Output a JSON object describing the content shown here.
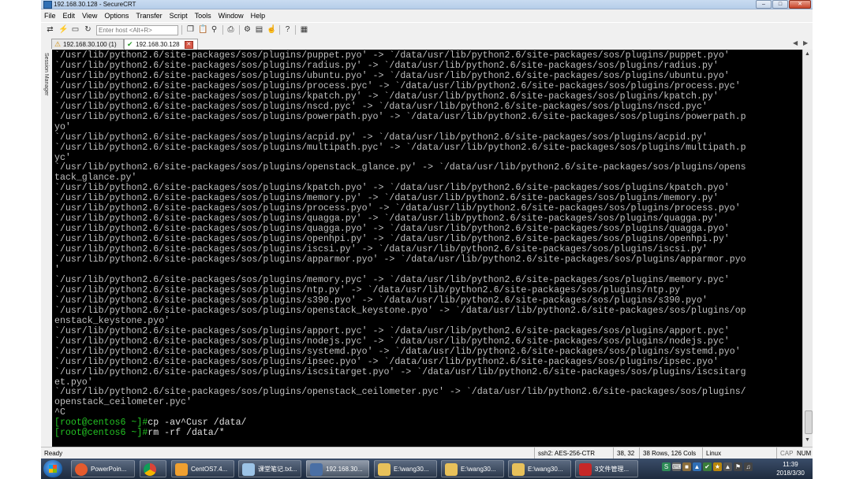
{
  "window": {
    "title": "192.168.30.128 - SecureCRT"
  },
  "menu": [
    "File",
    "Edit",
    "View",
    "Options",
    "Transfer",
    "Script",
    "Tools",
    "Window",
    "Help"
  ],
  "toolbar": {
    "host_placeholder": "Enter host <Alt+R>"
  },
  "tabs": [
    {
      "label": "192.168.30.100 (1)",
      "icon": "warning-icon"
    },
    {
      "label": "192.168.30.128",
      "icon": "check-icon",
      "active": true
    }
  ],
  "session_manager_label": "Session Manager",
  "terminal": {
    "lines": [
      "`/usr/lib/python2.6/site-packages/sos/plugins/puppet.pyo' -> `/data/usr/lib/python2.6/site-packages/sos/plugins/puppet.pyo'",
      "`/usr/lib/python2.6/site-packages/sos/plugins/radius.py' -> `/data/usr/lib/python2.6/site-packages/sos/plugins/radius.py'",
      "`/usr/lib/python2.6/site-packages/sos/plugins/ubuntu.pyo' -> `/data/usr/lib/python2.6/site-packages/sos/plugins/ubuntu.pyo'",
      "`/usr/lib/python2.6/site-packages/sos/plugins/process.pyc' -> `/data/usr/lib/python2.6/site-packages/sos/plugins/process.pyc'",
      "`/usr/lib/python2.6/site-packages/sos/plugins/kpatch.py' -> `/data/usr/lib/python2.6/site-packages/sos/plugins/kpatch.py'",
      "`/usr/lib/python2.6/site-packages/sos/plugins/nscd.pyc' -> `/data/usr/lib/python2.6/site-packages/sos/plugins/nscd.pyc'",
      "`/usr/lib/python2.6/site-packages/sos/plugins/powerpath.pyo' -> `/data/usr/lib/python2.6/site-packages/sos/plugins/powerpath.p",
      "yo'",
      "`/usr/lib/python2.6/site-packages/sos/plugins/acpid.py' -> `/data/usr/lib/python2.6/site-packages/sos/plugins/acpid.py'",
      "`/usr/lib/python2.6/site-packages/sos/plugins/multipath.pyc' -> `/data/usr/lib/python2.6/site-packages/sos/plugins/multipath.p",
      "yc'",
      "`/usr/lib/python2.6/site-packages/sos/plugins/openstack_glance.py' -> `/data/usr/lib/python2.6/site-packages/sos/plugins/opens",
      "tack_glance.py'",
      "`/usr/lib/python2.6/site-packages/sos/plugins/kpatch.pyo' -> `/data/usr/lib/python2.6/site-packages/sos/plugins/kpatch.pyo'",
      "`/usr/lib/python2.6/site-packages/sos/plugins/memory.py' -> `/data/usr/lib/python2.6/site-packages/sos/plugins/memory.py'",
      "`/usr/lib/python2.6/site-packages/sos/plugins/process.pyo' -> `/data/usr/lib/python2.6/site-packages/sos/plugins/process.pyo'",
      "`/usr/lib/python2.6/site-packages/sos/plugins/quagga.py' -> `/data/usr/lib/python2.6/site-packages/sos/plugins/quagga.py'",
      "`/usr/lib/python2.6/site-packages/sos/plugins/quagga.pyo' -> `/data/usr/lib/python2.6/site-packages/sos/plugins/quagga.pyo'",
      "`/usr/lib/python2.6/site-packages/sos/plugins/openhpi.py' -> `/data/usr/lib/python2.6/site-packages/sos/plugins/openhpi.py'",
      "`/usr/lib/python2.6/site-packages/sos/plugins/iscsi.py' -> `/data/usr/lib/python2.6/site-packages/sos/plugins/iscsi.py'",
      "`/usr/lib/python2.6/site-packages/sos/plugins/apparmor.pyo' -> `/data/usr/lib/python2.6/site-packages/sos/plugins/apparmor.pyo",
      "'",
      "`/usr/lib/python2.6/site-packages/sos/plugins/memory.pyc' -> `/data/usr/lib/python2.6/site-packages/sos/plugins/memory.pyc'",
      "`/usr/lib/python2.6/site-packages/sos/plugins/ntp.py' -> `/data/usr/lib/python2.6/site-packages/sos/plugins/ntp.py'",
      "`/usr/lib/python2.6/site-packages/sos/plugins/s390.pyo' -> `/data/usr/lib/python2.6/site-packages/sos/plugins/s390.pyo'",
      "`/usr/lib/python2.6/site-packages/sos/plugins/openstack_keystone.pyo' -> `/data/usr/lib/python2.6/site-packages/sos/plugins/op",
      "enstack_keystone.pyo'",
      "`/usr/lib/python2.6/site-packages/sos/plugins/apport.pyc' -> `/data/usr/lib/python2.6/site-packages/sos/plugins/apport.pyc'",
      "`/usr/lib/python2.6/site-packages/sos/plugins/nodejs.pyc' -> `/data/usr/lib/python2.6/site-packages/sos/plugins/nodejs.pyc'",
      "`/usr/lib/python2.6/site-packages/sos/plugins/systemd.pyo' -> `/data/usr/lib/python2.6/site-packages/sos/plugins/systemd.pyo'",
      "`/usr/lib/python2.6/site-packages/sos/plugins/ipsec.pyo' -> `/data/usr/lib/python2.6/site-packages/sos/plugins/ipsec.pyo'",
      "`/usr/lib/python2.6/site-packages/sos/plugins/iscsitarget.pyo' -> `/data/usr/lib/python2.6/site-packages/sos/plugins/iscsitarg",
      "et.pyo'",
      "`/usr/lib/python2.6/site-packages/sos/plugins/openstack_ceilometer.pyc' -> `/data/usr/lib/python2.6/site-packages/sos/plugins/",
      "openstack_ceilometer.pyc'",
      "^C"
    ],
    "prompt_lines": [
      {
        "prompt": "[root@centos6 ~]#",
        "command": "cp -av^Cusr /data/"
      },
      {
        "prompt": "[root@centos6 ~]#",
        "command": "rm -rf /data/*"
      }
    ]
  },
  "statusbar": {
    "ready": "Ready",
    "encryption": "ssh2: AES-256-CTR",
    "cursor_pos": "38, 32",
    "size": "38 Rows, 126 Cols",
    "os": "Linux",
    "cap": "CAP",
    "num": "NUM"
  },
  "taskbar": {
    "items": [
      {
        "label": "PowerPoin...",
        "icon": "powerpoint-icon",
        "color": "#d24726"
      },
      {
        "label": "",
        "icon": "chrome-icon",
        "color": "#4caf50"
      },
      {
        "label": "CentOS7.4...",
        "icon": "vm-icon",
        "color": "#f0a030"
      },
      {
        "label": "课堂笔记.txt...",
        "icon": "notepad-icon",
        "color": "#6fa8dc"
      },
      {
        "label": "192.168.30...",
        "icon": "securecrt-icon",
        "color": "#4a6fa5",
        "active": true
      },
      {
        "label": "E:\\wang30...",
        "icon": "folder-icon",
        "color": "#e8c15a"
      },
      {
        "label": "E:\\wang30...",
        "icon": "folder-icon",
        "color": "#e8c15a"
      },
      {
        "label": "E:\\wang30...",
        "icon": "folder-icon",
        "color": "#e8c15a"
      },
      {
        "label": "3文件管理...",
        "icon": "pdf-icon",
        "color": "#c62828"
      }
    ],
    "clock_time": "11:39",
    "clock_date": "2018/3/30"
  }
}
